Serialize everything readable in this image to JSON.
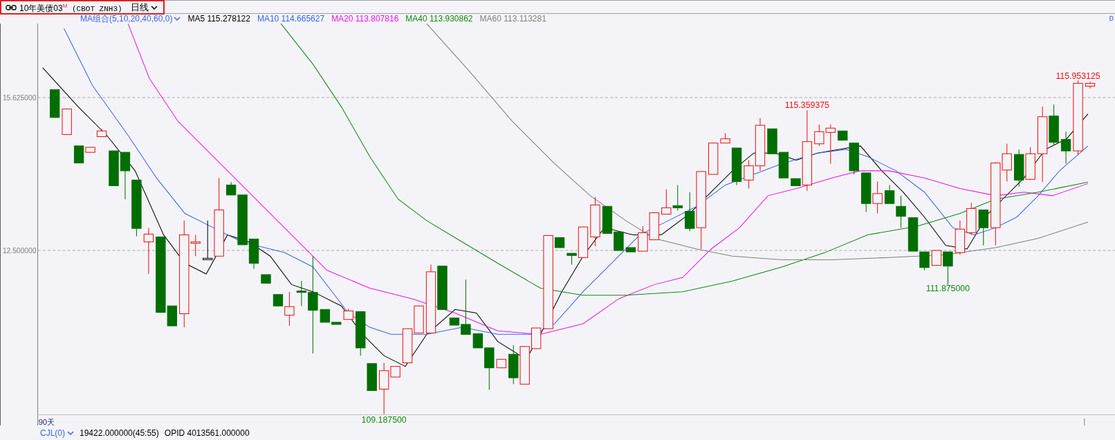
{
  "toolbar": {
    "symbol": "10年美债03",
    "symbol_mark": "M",
    "code": "(CBOT ZNH3)",
    "period": "日线"
  },
  "ma_legend": {
    "selector": "MA组合(5,10,20,40,60,0)",
    "items": [
      {
        "label": "MA5 115.278122",
        "color": "#000000"
      },
      {
        "label": "MA10 114.665627",
        "color": "#3366ee"
      },
      {
        "label": "MA20 113.807816",
        "color": "#ee11ee"
      },
      {
        "label": "MA40 113.930862",
        "color": "#118811"
      },
      {
        "label": "MA60 113.113281",
        "color": "#808080"
      }
    ]
  },
  "corner_label": "D",
  "y_axis": {
    "labels": [
      "15.625000",
      "12.500000"
    ]
  },
  "price_labels": [
    {
      "text": "115.359375",
      "kind": "high"
    },
    {
      "text": "115.953125",
      "kind": "high"
    },
    {
      "text": "109.187500",
      "kind": "low"
    },
    {
      "text": "111.875000",
      "kind": "low"
    }
  ],
  "range_label": "90天",
  "status_bar": {
    "indicator": "CJL(0)",
    "value": "19422.000000(45:55)",
    "opid": "OPID 4013561.000000"
  }
}
